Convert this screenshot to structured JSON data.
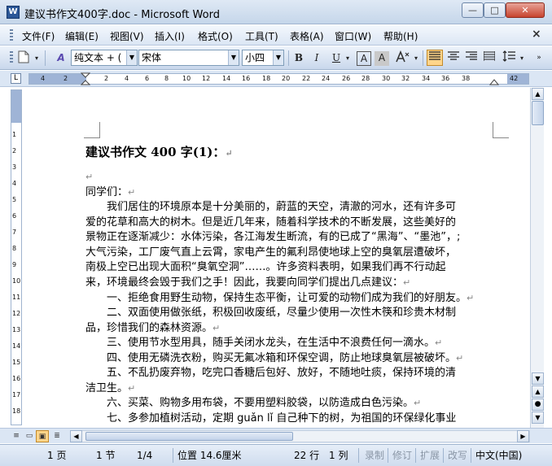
{
  "window": {
    "title": "建议书作文400字.doc - Microsoft Word",
    "min_glyph": "—",
    "max_glyph": "□",
    "close_glyph": "✕"
  },
  "menu": {
    "items": [
      "文件(F)",
      "编辑(E)",
      "视图(V)",
      "插入(I)",
      "格式(O)",
      "工具(T)",
      "表格(A)",
      "窗口(W)",
      "帮助(H)"
    ],
    "close_glyph": "×"
  },
  "toolbar": {
    "style": "纯文本 + (",
    "font": "宋体",
    "size": "小四",
    "bold": "B",
    "italic": "I",
    "underline": "U",
    "font_color_glyph": "A",
    "char_border_glyph": "A"
  },
  "ruler": {
    "corner": "L",
    "ticks": [
      "4",
      "2",
      "2",
      "4",
      "6",
      "8",
      "10",
      "12",
      "14",
      "16",
      "18",
      "20",
      "22",
      "24",
      "26",
      "28",
      "30",
      "32",
      "34",
      "36",
      "38",
      "42"
    ],
    "vticks": [
      "1",
      "2",
      "3",
      "4",
      "5",
      "6",
      "7",
      "8",
      "9",
      "10",
      "11",
      "12",
      "13",
      "14",
      "15",
      "16",
      "17",
      "18"
    ]
  },
  "document": {
    "heading": "建议书作文 400 字(1)：",
    "lines": [
      "",
      "同学们：",
      "　　我们居住的环境原本是十分美丽的，蔚蓝的天空，清澈的河水，还有许多可",
      "爱的花草和高大的树木。但是近几年来，随着科学技术的不断发展，这些美好的",
      "景物正在逐渐减少：水体污染，各江海发生断流，有的已成了“黑海”、“墨池”，;",
      "大气污染，工厂废气直上云霄，家电产生的氟利昂使地球上空的臭氧层遭破坏，",
      "南极上空已出现大面积“臭氧空洞”……。许多资料表明，如果我们再不行动起",
      "来，环境最终会毁于我们之手！因此，我要向同学们提出几点建议：",
      "　　一、拒绝食用野生动物，保持生态平衡，让可爱的动物们成为我们的好朋友。",
      "　　二、双面使用做张纸，积极回收废纸，尽量少使用一次性木筷和珍贵木材制",
      "品，珍惜我们的森林资源。",
      "　　三、使用节水型用具，随手关闭水龙头，在生活中不浪费任何一滴水。",
      "　　四、使用无磷洗衣粉，购买无氟冰箱和环保空调，防止地球臭氧层被破坏。",
      "　　五、不乱扔废弃物，吃完口香糖后包好、放好，不随地吐痰，保持环境的清",
      "洁卫生。",
      "　　六、买菜、购物多用布袋，不要用塑料胶袋，以防造成白色污染。",
      "　　七、多参加植树活动，定期 guǎn lǐ 自己种下的树，为祖国的环保绿化事业"
    ],
    "para_mark": "↵"
  },
  "statusbar": {
    "page": "1 页",
    "section": "1 节",
    "page_of": "1/4",
    "position": "位置 14.6厘米",
    "line": "22 行",
    "col": "1 列",
    "rec": "录制",
    "rev": "修订",
    "ext": "扩展",
    "ovr": "改写",
    "lang": "中文(中国)"
  }
}
